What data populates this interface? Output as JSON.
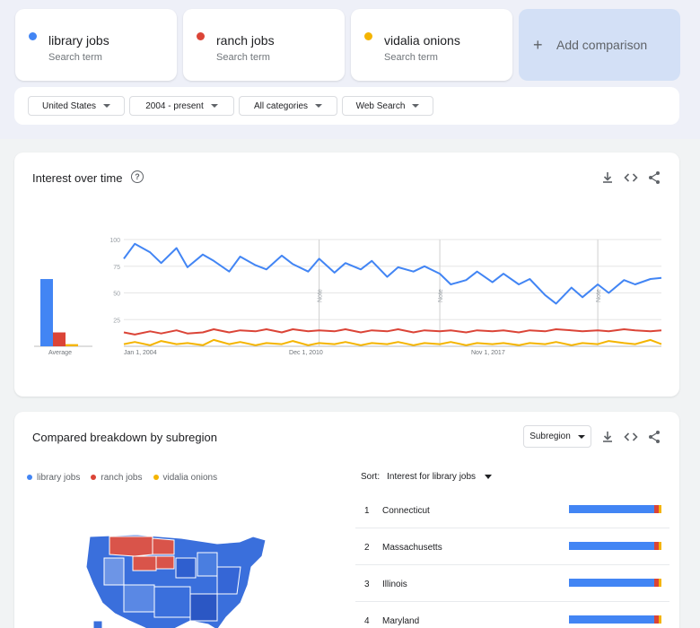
{
  "terms": [
    {
      "name": "library jobs",
      "sub": "Search term",
      "color": "#4285f4"
    },
    {
      "name": "ranch jobs",
      "sub": "Search term",
      "color": "#db4437"
    },
    {
      "name": "vidalia onions",
      "sub": "Search term",
      "color": "#f4b400"
    }
  ],
  "add_comparison": "Add comparison",
  "filters": {
    "region": "United States",
    "time": "2004 - present",
    "category": "All categories",
    "property": "Web Search"
  },
  "interest": {
    "title": "Interest over time",
    "help_icon": "help-circle-icon",
    "average_label": "Average",
    "averages": {
      "library_jobs": 63,
      "ranch_jobs": 13,
      "vidalia_onions": 2
    },
    "note_label": "Note",
    "note_dates": [
      "2011-06",
      "2016-01",
      "2022-01"
    ]
  },
  "chart_data": {
    "type": "line",
    "title": "",
    "xlabel": "",
    "ylabel": "",
    "ylim": [
      0,
      100
    ],
    "yticks": [
      25,
      50,
      75,
      100
    ],
    "ytick_labels": [
      "25",
      "50",
      "75",
      "100"
    ],
    "xtick_labels": [
      "Jan 1, 2004",
      "Dec 1, 2010",
      "Nov 1, 2017"
    ],
    "xlim": [
      "2004-01",
      "2024-06"
    ],
    "grid": true,
    "x": [
      "2004-01",
      "2004-06",
      "2005-01",
      "2005-06",
      "2006-01",
      "2006-06",
      "2007-01",
      "2007-06",
      "2008-01",
      "2008-06",
      "2009-01",
      "2009-06",
      "2010-01",
      "2010-06",
      "2011-01",
      "2011-06",
      "2012-01",
      "2012-06",
      "2013-01",
      "2013-06",
      "2014-01",
      "2014-06",
      "2015-01",
      "2015-06",
      "2016-01",
      "2016-06",
      "2017-01",
      "2017-06",
      "2018-01",
      "2018-06",
      "2019-01",
      "2019-06",
      "2020-01",
      "2020-06",
      "2021-01",
      "2021-06",
      "2022-01",
      "2022-06",
      "2023-01",
      "2023-06",
      "2024-01",
      "2024-06"
    ],
    "series": [
      {
        "name": "library jobs",
        "color": "#4285f4",
        "values": [
          82,
          96,
          88,
          78,
          92,
          74,
          86,
          80,
          70,
          84,
          76,
          72,
          85,
          77,
          70,
          82,
          69,
          78,
          72,
          80,
          65,
          74,
          70,
          75,
          68,
          58,
          62,
          70,
          60,
          68,
          58,
          63,
          48,
          40,
          55,
          46,
          58,
          50,
          62,
          58,
          63,
          64
        ]
      },
      {
        "name": "ranch jobs",
        "color": "#db4437",
        "values": [
          13,
          11,
          14,
          12,
          15,
          12,
          13,
          16,
          13,
          15,
          14,
          16,
          13,
          16,
          14,
          15,
          14,
          16,
          13,
          15,
          14,
          16,
          13,
          15,
          14,
          15,
          13,
          15,
          14,
          15,
          13,
          15,
          14,
          16,
          15,
          14,
          15,
          14,
          16,
          15,
          14,
          15
        ]
      },
      {
        "name": "vidalia onions",
        "color": "#f4b400",
        "values": [
          2,
          4,
          1,
          5,
          2,
          3,
          1,
          6,
          2,
          4,
          1,
          3,
          2,
          5,
          1,
          3,
          2,
          4,
          1,
          3,
          2,
          4,
          1,
          3,
          2,
          4,
          1,
          3,
          2,
          3,
          1,
          3,
          2,
          4,
          1,
          3,
          2,
          5,
          3,
          2,
          6,
          2
        ]
      }
    ]
  },
  "breakdown": {
    "title": "Compared breakdown by subregion",
    "select_label": "Subregion",
    "legend": [
      "library jobs",
      "ranch jobs",
      "vidalia onions"
    ],
    "sort_prefix": "Sort:",
    "sort_value": "Interest for library jobs",
    "rows": [
      {
        "rank": "1",
        "name": "Connecticut",
        "shares": [
          0.92,
          0.05,
          0.03
        ]
      },
      {
        "rank": "2",
        "name": "Massachusetts",
        "shares": [
          0.92,
          0.05,
          0.03
        ]
      },
      {
        "rank": "3",
        "name": "Illinois",
        "shares": [
          0.92,
          0.05,
          0.03
        ]
      },
      {
        "rank": "4",
        "name": "Maryland",
        "shares": [
          0.92,
          0.05,
          0.03
        ]
      }
    ]
  },
  "icons": {
    "download": "download-icon",
    "embed": "embed-code-icon",
    "share": "share-icon",
    "plus": "plus-icon"
  }
}
